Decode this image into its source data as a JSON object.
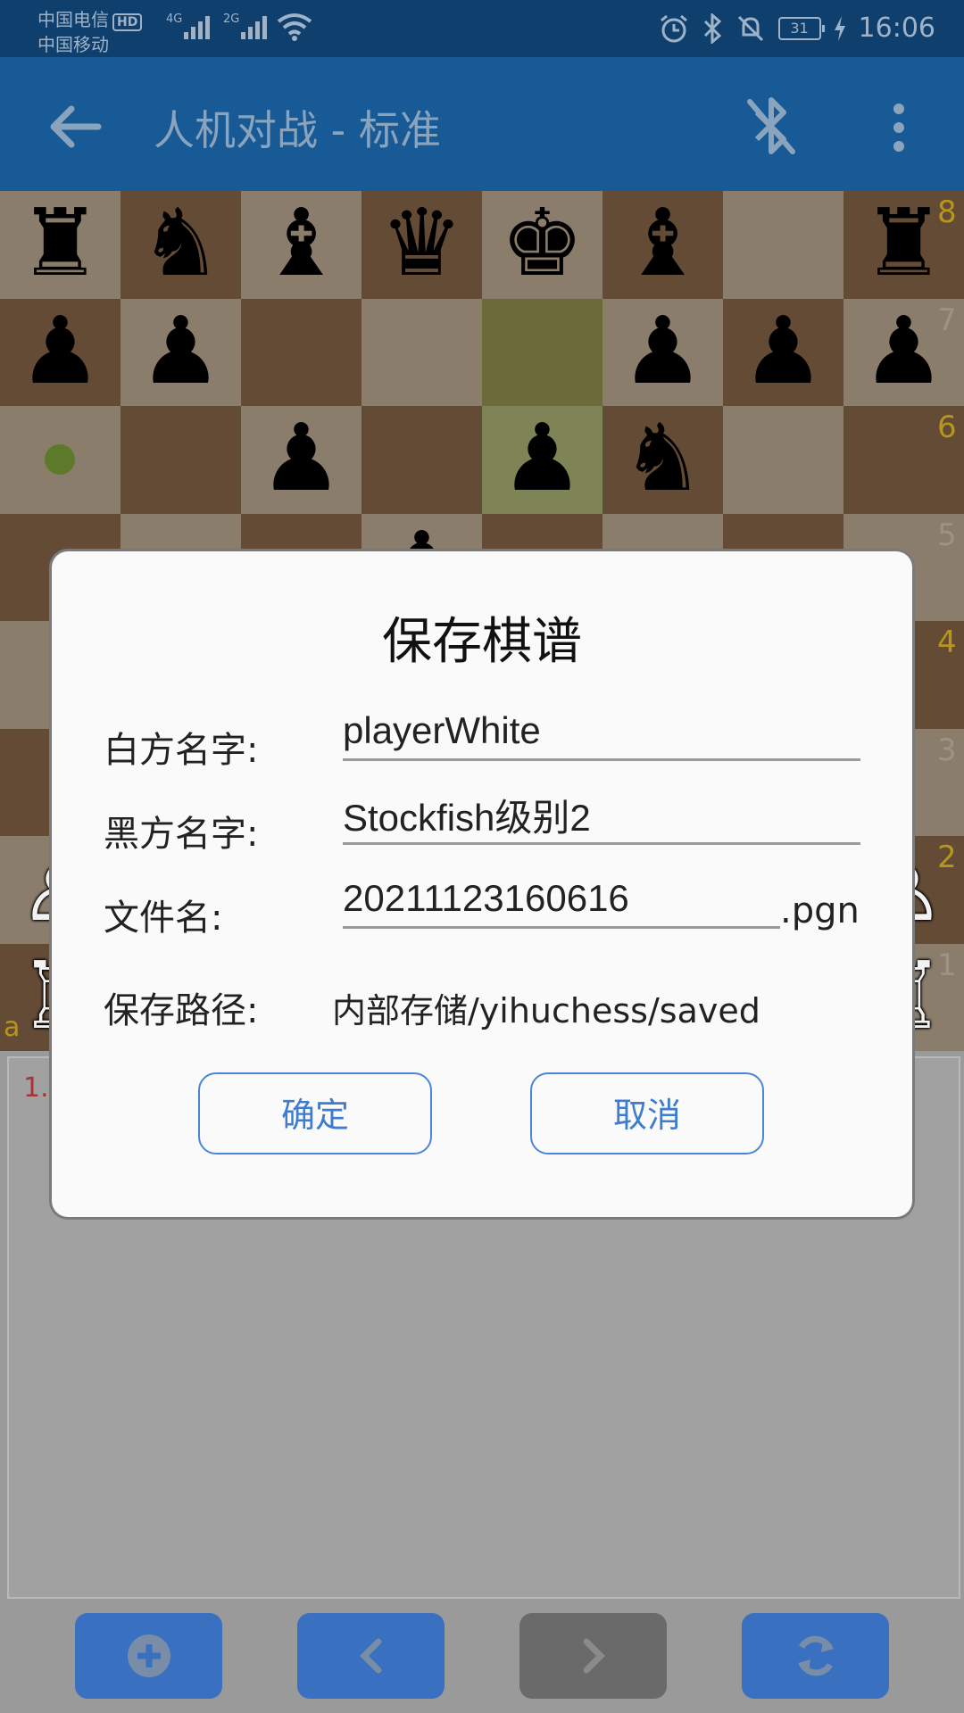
{
  "status_bar": {
    "carrier1": "中国电信",
    "carrier1_badge": "HD",
    "carrier2": "中国移动",
    "network1": "4G",
    "network2": "2G",
    "battery": "31",
    "time": "16:06"
  },
  "app_bar": {
    "title": "人机对战 - 标准",
    "back_icon": "arrow-back-icon",
    "bluetooth_icon": "bluetooth-disabled-icon",
    "menu_icon": "more-vert-icon"
  },
  "board": {
    "ranks": [
      "8",
      "7",
      "6",
      "5",
      "4",
      "3",
      "2",
      "1"
    ],
    "file_label": "a",
    "rank8": [
      "♜",
      "♞",
      "♝",
      "♛",
      "♚",
      "♝",
      "",
      "♜"
    ],
    "rank7": [
      "♟",
      "♟",
      "",
      "",
      "",
      "♟",
      "♟",
      "♟"
    ],
    "rank6": [
      "",
      "",
      "♟",
      "",
      "♟",
      "♞",
      "",
      ""
    ],
    "white_pieces_edge": [
      "♙",
      "♖",
      "♙",
      "♖"
    ]
  },
  "move_list": {
    "start": "1."
  },
  "dialog": {
    "title": "保存棋谱",
    "white_label": "白方名字:",
    "white_value": "playerWhite",
    "black_label": "黑方名字:",
    "black_value": "Stockfish级别2",
    "file_label": "文件名:",
    "file_value": "20211123160616",
    "file_ext": ".pgn",
    "path_label": "保存路径:",
    "path_value": "内部存储/yihuchess/saved",
    "ok_label": "确定",
    "cancel_label": "取消"
  },
  "toolbar": {
    "icons": [
      "add-circle-icon",
      "chevron-left-icon",
      "chevron-right-icon",
      "rotate-icon"
    ]
  },
  "colors": {
    "app_bar": "#175a96",
    "status_bar": "#0f3f6c",
    "accent": "#3e7cd0",
    "rank_label": "#b6961d"
  }
}
